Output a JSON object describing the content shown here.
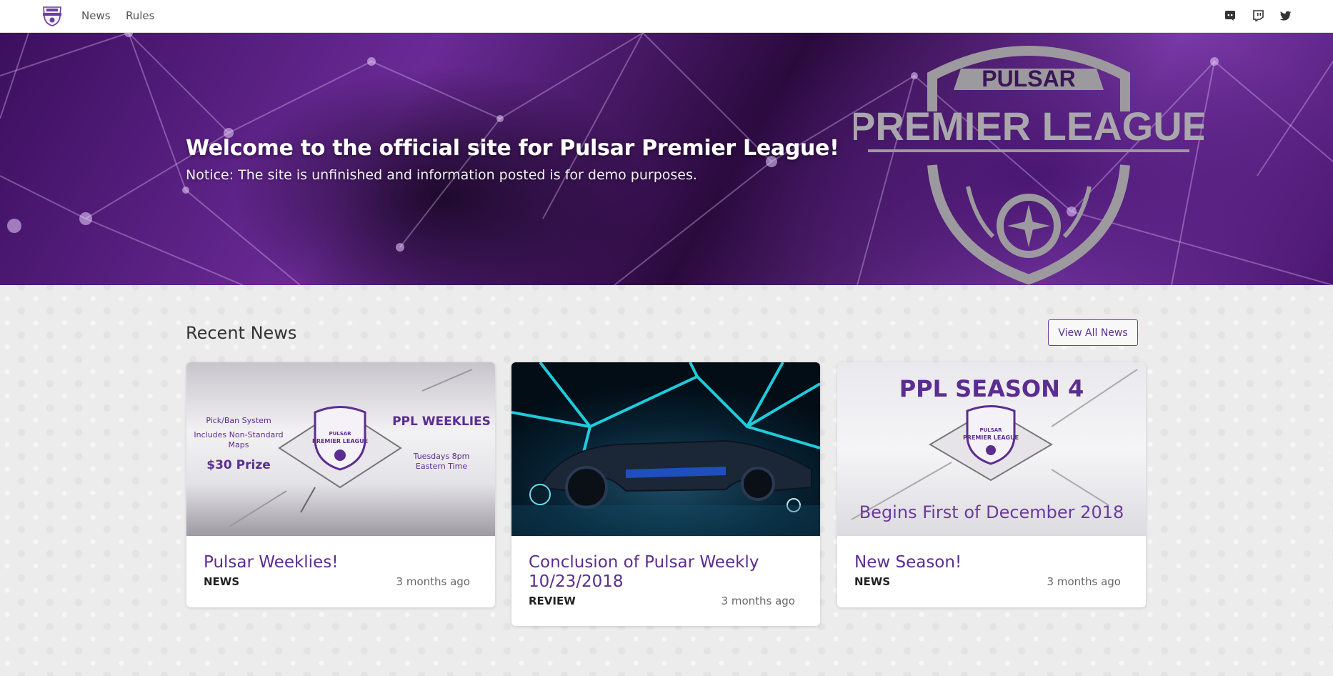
{
  "nav": {
    "links": [
      "News",
      "Rules"
    ],
    "social": [
      "discord-icon",
      "twitch-icon",
      "twitter-icon"
    ]
  },
  "hero": {
    "title": "Welcome to the official site for Pulsar Premier League!",
    "notice": "Notice: The site is unfinished and information posted is for demo purposes.",
    "emblem_top": "PULSAR",
    "emblem_main": "PREMIER LEAGUE"
  },
  "news": {
    "heading": "Recent News",
    "view_all": "View All News",
    "cards": [
      {
        "title": "Pulsar Weeklies!",
        "category": "NEWS",
        "time": "3 months ago",
        "image": {
          "left_text_1": "Pick/Ban System",
          "left_text_2": "Includes Non-Standard",
          "left_text_3": "Maps",
          "prize": "$30 Prize",
          "right_title": "PPL WEEKLIES",
          "right_text_1": "Tuesdays 8pm",
          "right_text_2": "Eastern Time",
          "badge_top": "PULSAR",
          "badge_main": "PREMIER LEAGUE"
        }
      },
      {
        "title": "Conclusion of Pulsar Weekly 10/23/2018",
        "category": "REVIEW",
        "time": "3 months ago"
      },
      {
        "title": "New Season!",
        "category": "NEWS",
        "time": "3 months ago",
        "image": {
          "headline": "PPL SEASON 4",
          "footer": "Begins First of December 2018",
          "badge_top": "PULSAR",
          "badge_main": "PREMIER LEAGUE"
        }
      }
    ]
  },
  "colors": {
    "accent": "#5c2d91",
    "hero_purple": "#6a2a96",
    "navbar": "#ffffff"
  }
}
